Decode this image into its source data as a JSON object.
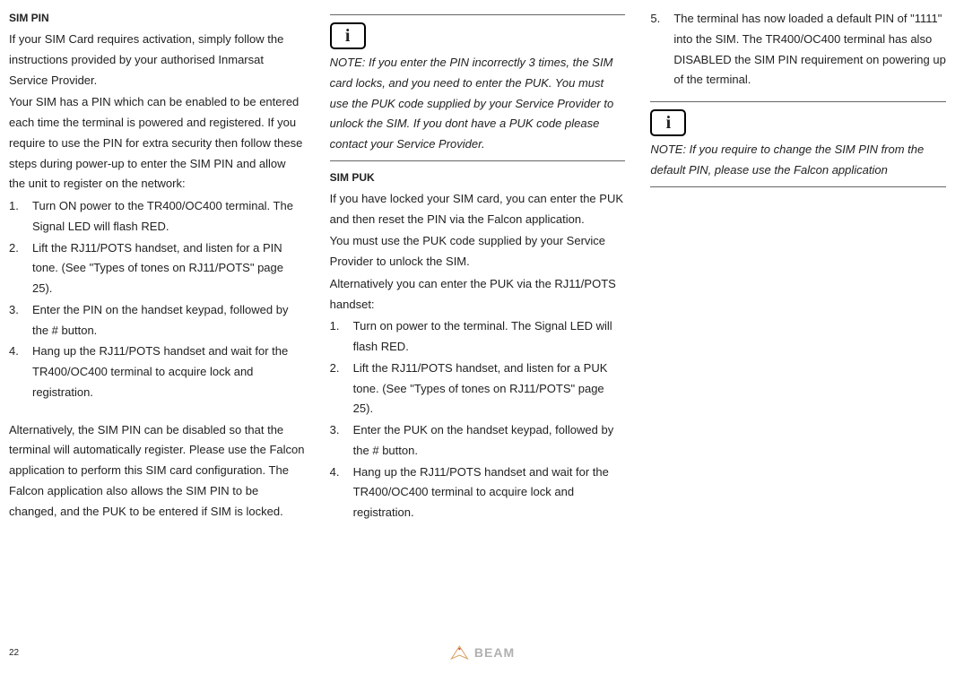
{
  "col1": {
    "title": "SIM PIN",
    "intro": "If your SIM Card requires activation, simply follow the instructions provided by your authorised Inmarsat Service Provider.",
    "p2": "Your SIM has a PIN which can be enabled to be entered each time the terminal is powered and registered.  If you require to use the PIN for extra security then follow these steps during power-up to enter the SIM PIN and allow the unit to register on the network:",
    "items": [
      {
        "n": "1.",
        "t": "Turn ON power to the TR400/OC400 terminal.  The Signal LED will flash RED."
      },
      {
        "n": "2.",
        "t": "Lift the RJ11/POTS handset, and listen for a PIN tone. (See \"Types of tones on RJ11/POTS\" page 25)."
      },
      {
        "n": "3.",
        "t": "Enter the PIN on the handset keypad, followed by the  # button."
      },
      {
        "n": "4.",
        "t": "Hang up the RJ11/POTS handset and wait for the TR400/OC400 terminal to acquire lock and registration."
      }
    ],
    "p3": "Alternatively, the SIM PIN can be disabled so that the terminal will automatically register.  Please use the Falcon application to perform this SIM card configuration. The Falcon application also allows the SIM PIN to be changed, and the PUK to be entered if SIM is locked."
  },
  "col2": {
    "note": "NOTE:  If you enter the PIN incorrectly 3 times, the SIM card locks, and you need to enter the PUK.  You must use the PUK code supplied by your Service Provider to unlock the SIM. If you dont have a PUK code please contact your Service Provider.",
    "title": "SIM PUK",
    "p1": "If you have locked your SIM card, you can enter the PUK and then reset the PIN via the Falcon application.",
    "p2": "You must use the PUK code supplied by your Service Provider to unlock the SIM.",
    "p3": "Alternatively you can enter the PUK via the RJ11/POTS handset:",
    "items": [
      {
        "n": "1.",
        "t": "Turn on power to the terminal.  The Signal LED will flash RED."
      },
      {
        "n": "2.",
        "t": "Lift the RJ11/POTS handset, and listen for a PUK tone. (See \"Types of tones on RJ11/POTS\" page 25)."
      },
      {
        "n": "3.",
        "t": "Enter the PUK on the handset keypad, followed by the  # button."
      },
      {
        "n": "4.",
        "t": "Hang up the RJ11/POTS handset and wait for the TR400/OC400 terminal to acquire lock and registration."
      }
    ]
  },
  "col3": {
    "items": [
      {
        "n": "5.",
        "t": "The terminal has now loaded a default PIN of \"1111\" into the SIM.  The TR400/OC400 terminal has also DISABLED the SIM PIN requirement on powering up of the terminal."
      }
    ],
    "note": "NOTE:  If you require to change the SIM PIN from the default PIN, please use the Falcon application"
  },
  "info_glyph": "i",
  "page_number": "22",
  "logo_text": "BEAM"
}
